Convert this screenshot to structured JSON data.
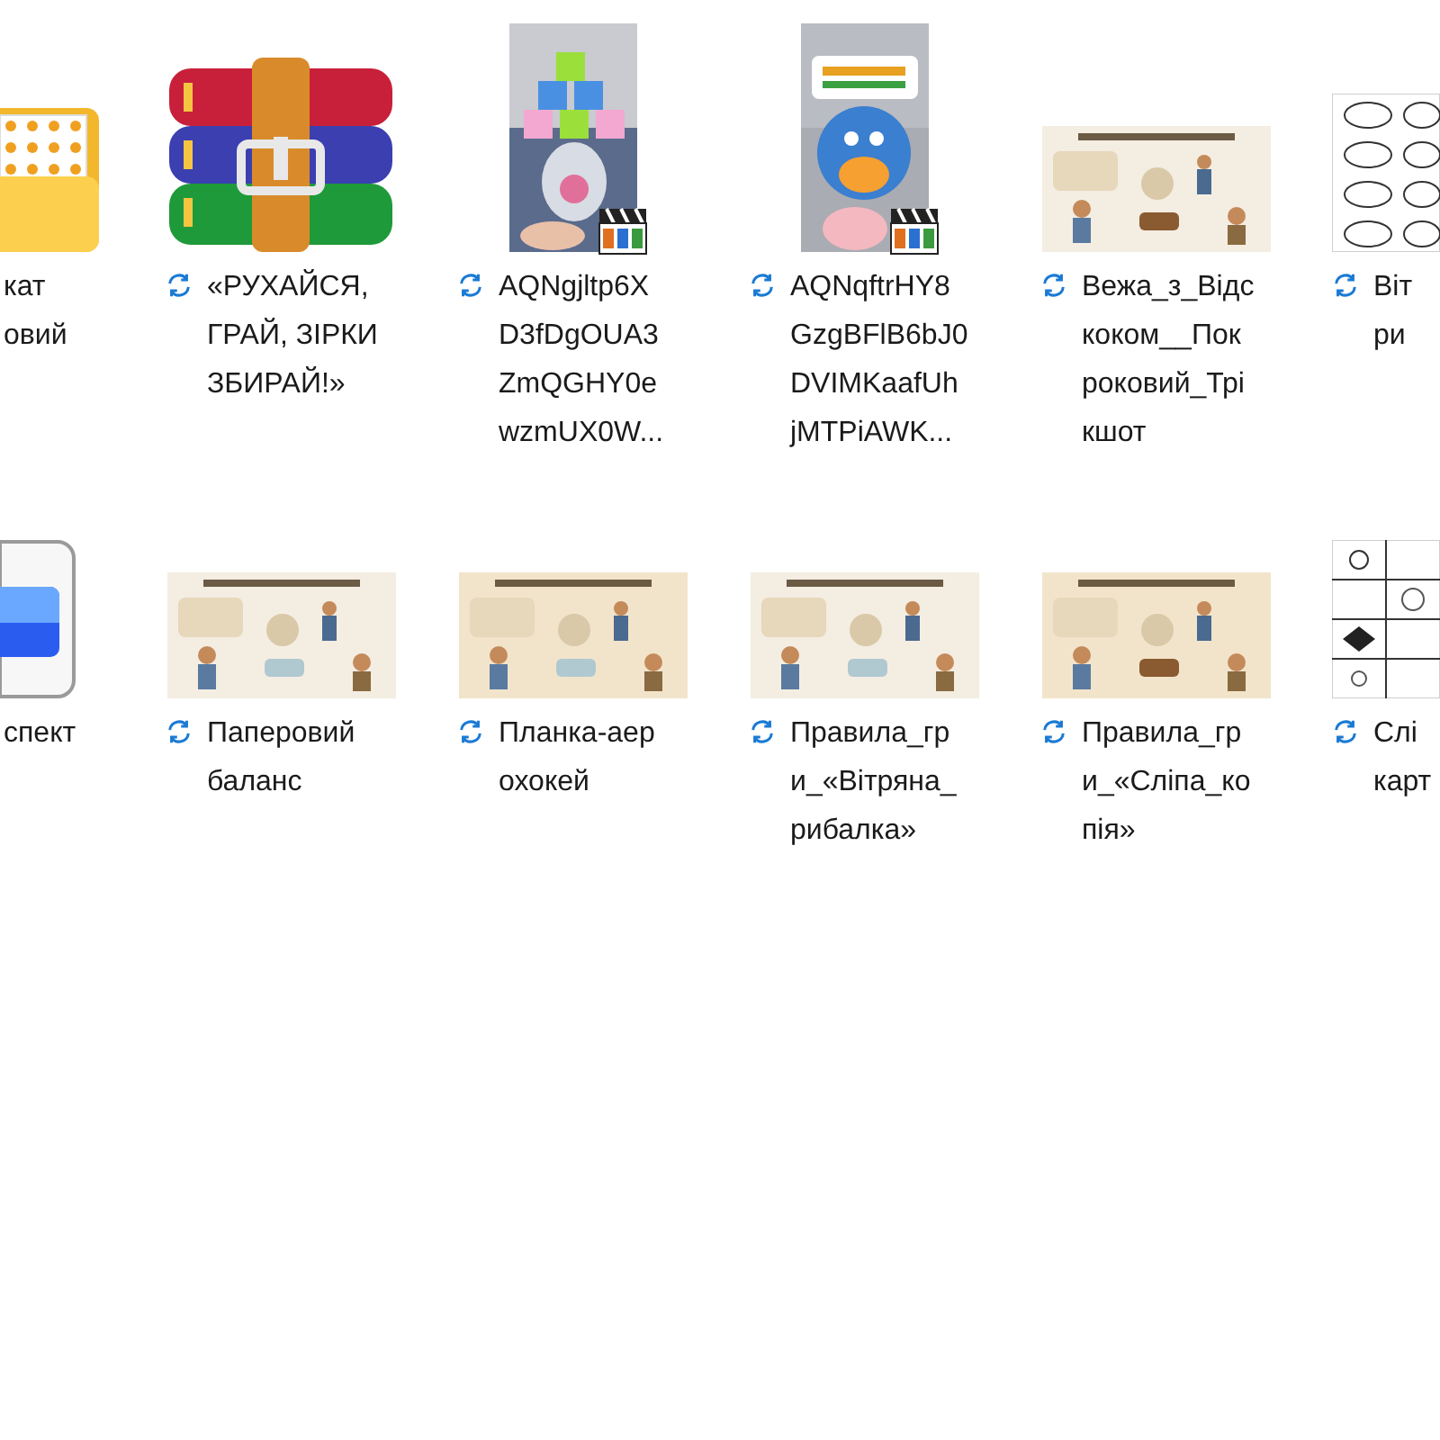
{
  "rows": [
    {
      "items": [
        {
          "kind": "folder",
          "lines": [
            "кат",
            "овий"
          ]
        },
        {
          "kind": "archive",
          "synced": true,
          "lines": [
            "«РУХАЙСЯ,",
            "ГРАЙ, ЗІРКИ",
            "ЗБИРАЙ!»"
          ]
        },
        {
          "kind": "video",
          "synced": true,
          "lines": [
            "AQNgjltp6X",
            "D3fDgOUA3",
            "ZmQGHY0e",
            "wzmUX0W..."
          ]
        },
        {
          "kind": "video",
          "synced": true,
          "lines": [
            "AQNqftrHY8",
            "GzgBFlB6bJ0",
            "DVIMKaafUh",
            "jMTPiAWK..."
          ]
        },
        {
          "synced": true,
          "lines": [
            "Вежа_з_Відс",
            "коком__Пок",
            "роковий_Трі",
            "кшот"
          ]
        },
        {
          "kind": "worksheet",
          "synced": true,
          "lines": [
            "Віт",
            "ри"
          ]
        }
      ]
    },
    {
      "items": [
        {
          "kind": "app",
          "lines": [
            "спект"
          ]
        },
        {
          "synced": true,
          "lines": [
            "Паперовий",
            "баланс"
          ]
        },
        {
          "synced": true,
          "lines": [
            "Планка-аер",
            "охокей"
          ]
        },
        {
          "synced": true,
          "lines": [
            "Правила_гр",
            "и_«Вітряна_",
            "рибалка»"
          ]
        },
        {
          "synced": true,
          "lines": [
            "Правила_гр",
            "и_«Сліпа_ко",
            "пія»"
          ]
        },
        {
          "kind": "worksheet",
          "synced": true,
          "lines": [
            "Слі",
            "карт"
          ]
        }
      ]
    }
  ]
}
